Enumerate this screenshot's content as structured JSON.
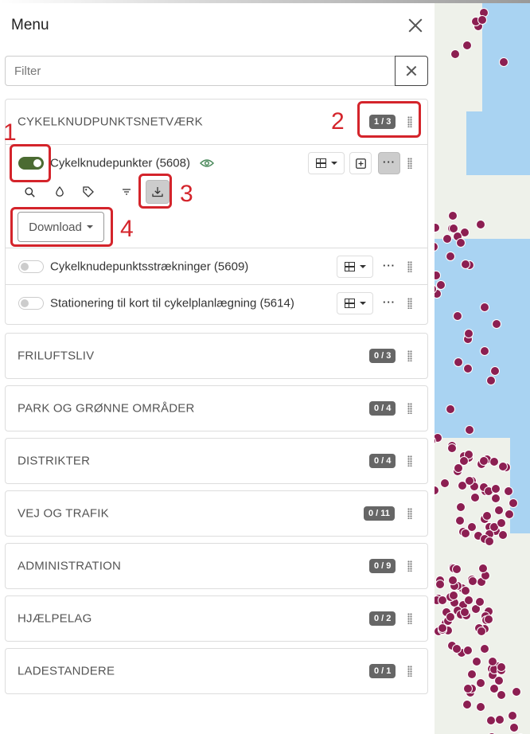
{
  "menu": {
    "title": "Menu"
  },
  "filter": {
    "placeholder": "Filter"
  },
  "groups": [
    {
      "title": "CYKELKNUDPUNKTSNETVÆRK",
      "badge": "1 / 3"
    },
    {
      "title": "FRILUFTSLIV",
      "badge": "0 / 3"
    },
    {
      "title": "PARK OG GRØNNE OMRÅDER",
      "badge": "0 / 4"
    },
    {
      "title": "DISTRIKTER",
      "badge": "0 / 4"
    },
    {
      "title": "VEJ OG TRAFIK",
      "badge": "0 / 11"
    },
    {
      "title": "ADMINISTRATION",
      "badge": "0 / 9"
    },
    {
      "title": "HJÆLPELAG",
      "badge": "0 / 2"
    },
    {
      "title": "LADESTANDERE",
      "badge": "0 / 1"
    }
  ],
  "layers": [
    {
      "label": "Cykelknudepunkter (5608)",
      "enabled": true
    },
    {
      "label": "Cykelknudepunktsstrækninger (5609)",
      "enabled": false
    },
    {
      "label": "Stationering til kort til cykelplanlægning (5614)",
      "enabled": false
    }
  ],
  "download": {
    "label": "Download"
  },
  "annotations": [
    "1",
    "2",
    "3",
    "4"
  ],
  "colors": {
    "toggle_on": "#4b6b32",
    "annotation_red": "#d4242b",
    "map_marker": "#8c1f52",
    "sea": "#a9d3f2"
  }
}
